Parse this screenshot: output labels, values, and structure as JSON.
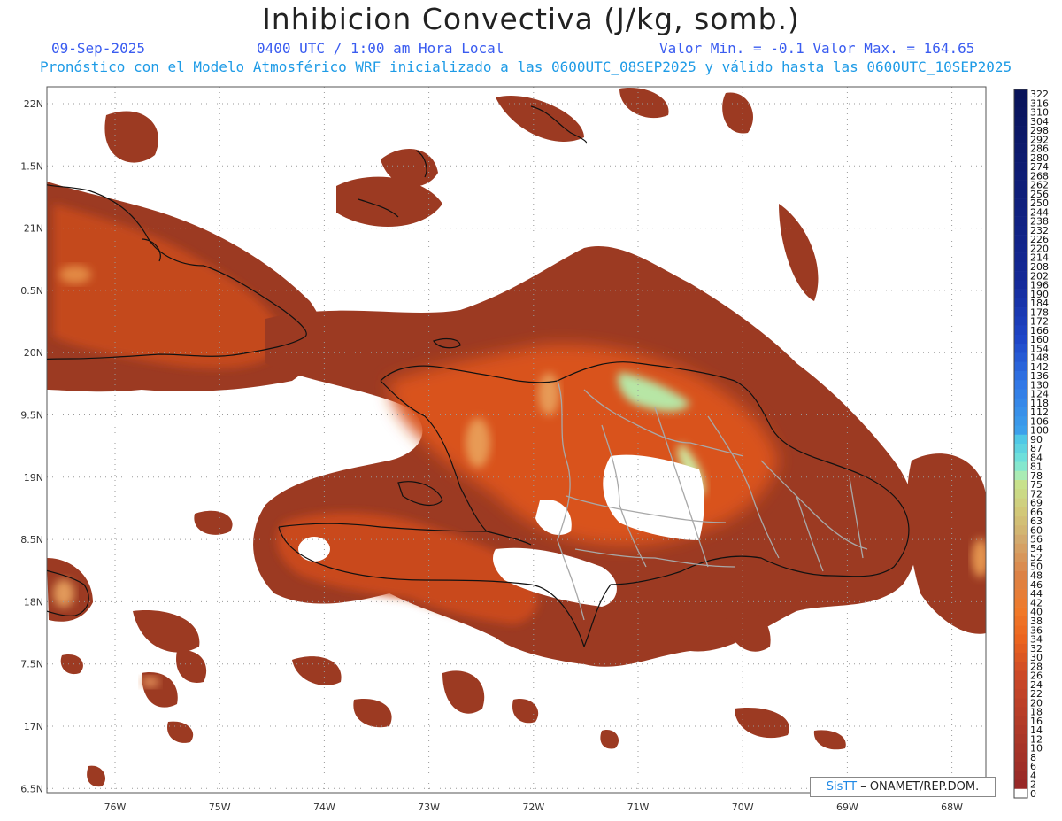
{
  "header": {
    "title": "Inhibicion Convectiva (J/kg, somb.)",
    "date": "09-Sep-2025",
    "time": "0400 UTC / 1:00 am Hora Local",
    "minmax": "Valor Min. = -0.1  Valor Max. = 164.65",
    "model_line": "Pronóstico con el Modelo Atmosférico WRF inicializado a las 0600UTC_08SEP2025 y válido hasta las  0600UTC_10SEP2025"
  },
  "map": {
    "lat_labels": [
      "22N",
      "1.5N",
      "21N",
      "0.5N",
      "20N",
      "9.5N",
      "19N",
      "8.5N",
      "18N",
      "7.5N",
      "17N",
      "6.5N"
    ],
    "lon_labels": [
      "76W",
      "75W",
      "74W",
      "73W",
      "72W",
      "71W",
      "70W",
      "69W",
      "68W"
    ],
    "lat_range": [
      16.5,
      22.0
    ],
    "lon_range": [
      -76.7,
      -67.6
    ],
    "grid": true,
    "colors": {
      "background_field": "#9c3a22",
      "high_field": "#f06a1a",
      "peak_field": "#b7e6a5",
      "land_outline": "#111111",
      "province_lines": "#a8a8a8"
    }
  },
  "colorbar": {
    "labels": [
      "322",
      "316",
      "310",
      "304",
      "298",
      "292",
      "286",
      "280",
      "274",
      "268",
      "262",
      "256",
      "250",
      "244",
      "238",
      "232",
      "226",
      "220",
      "214",
      "208",
      "202",
      "196",
      "190",
      "184",
      "178",
      "172",
      "166",
      "160",
      "154",
      "148",
      "142",
      "136",
      "130",
      "124",
      "118",
      "112",
      "106",
      "100",
      "90",
      "87",
      "84",
      "81",
      "78",
      "75",
      "72",
      "69",
      "66",
      "63",
      "60",
      "56",
      "54",
      "52",
      "50",
      "48",
      "46",
      "44",
      "42",
      "40",
      "38",
      "36",
      "34",
      "32",
      "30",
      "28",
      "26",
      "24",
      "22",
      "20",
      "18",
      "16",
      "14",
      "12",
      "10",
      "8",
      "6",
      "4",
      "2",
      "0"
    ]
  },
  "credit": {
    "brand": "SisTT",
    "text": " – ONAMET/REP.DOM."
  }
}
